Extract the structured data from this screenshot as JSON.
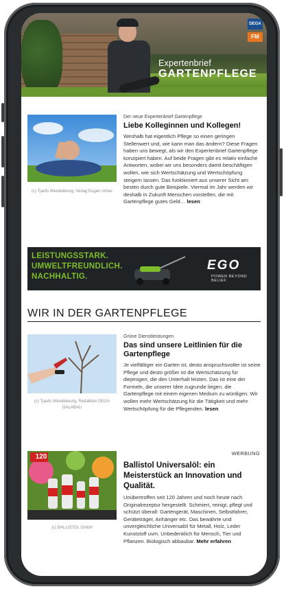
{
  "header": {
    "kicker": "Expertenbrief",
    "title": "GARTENPFLEGE",
    "logo_dega": "DEGA",
    "logo_fm": "FM"
  },
  "article1": {
    "kicker": "Der neue Expertenbrief Gartenpflege",
    "title": "Liebe Kolleginnen und Kollegen!",
    "body": "Weshalb hat eigentlich Pflege so einen geringen Stellenwert und, wie kann man das ändern? Diese Fragen haben uns bewegt, als wir den Expertenbrief Gartenpflege konzipiert haben. Auf beide Fragen gibt es relativ einfache Antworten, wobei wir uns besonders damit beschäftigen wollen, wie sich Wertschätzung und Wertschöpfung steigern lassen. Das funktioniert aus unserer Sicht am besten durch gute Beispiele. Viermal im Jahr werden wir deshalb in Zukunft Menschen vorstellen, die mit Gartenpflege gutes Geld…",
    "more": "lesen",
    "caption": "(c) Tjards Wendebourg, Verlag Eugen Ulmer"
  },
  "ego_ad": {
    "line1": "LEISTUNGSSTARK.",
    "line2": "UMWELTFREUNDLICH.",
    "line3": "NACHHALTIG.",
    "brand": "EGO",
    "tagline": "POWER BEYOND BELIEF"
  },
  "section": {
    "title": "WIR IN DER GARTENPFLEGE"
  },
  "article2": {
    "kicker": "Grüne Dienstleistungen",
    "title": "Das sind unsere Leitlinien für die Gartenpflege",
    "body": "Je vielfältiger ein Garten ist, desto anspruchsvoller ist seine Pflege und desto größer ist die Wertschätzung für diejenigen, die den Unterhalt leisten. Das ist eine der Formeln, die unserer Idee zugrunde liegen, die Gartenpflege mit einem eigenen Medium zu würdigen. Wir wollen mehr Wertschätzung für die Tätigkeit und mehr Wertschöpfung für die Pflegenden.",
    "more": "lesen",
    "caption": "(c) Tjards Wendebourg, Redaktion DEGA GALABAU"
  },
  "article3": {
    "label": "WERBUNG",
    "title": "Ballistol Universalöl: ein Meisterstück an Innovation und Qualität.",
    "body": "Unübertroffen seit 120 Jahren und noch heute nach Originalrezeptur hergestellt. Schmiert, reinigt, pflegt und schützt überall: Gartengerät, Maschinen, Selbstfahrer, Geräteträger, Anhänger etc. Das bewährte und unvergleichliche Universalöl für Metall, Holz, Leder Kunststoff uvm. Unbedenklich für Mensch, Tier und Pflanzen. Biologisch abbaubar.",
    "more": "Mehr erfahren",
    "caption": "(c) BALLISTOL GmbH",
    "badge": "120"
  }
}
